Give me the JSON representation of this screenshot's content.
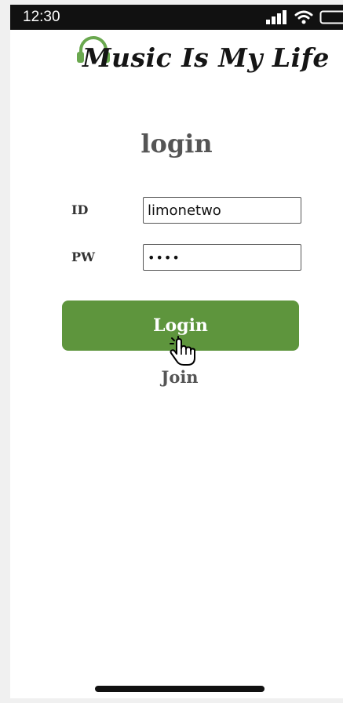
{
  "status_bar": {
    "time": "12:30",
    "icons": [
      "signal-icon",
      "wifi-icon",
      "battery-icon"
    ]
  },
  "logo": {
    "text": "Music Is My Life",
    "icon": "headphones-icon",
    "icon_color": "#6aa84f"
  },
  "page_title": "login",
  "form": {
    "id_label": "ID",
    "id_value": "limonetwo",
    "pw_label": "PW",
    "pw_value": "••••"
  },
  "buttons": {
    "login_label": "Login",
    "login_color": "#5e953d",
    "join_label": "Join"
  },
  "cursor": "hand-pointer-icon"
}
